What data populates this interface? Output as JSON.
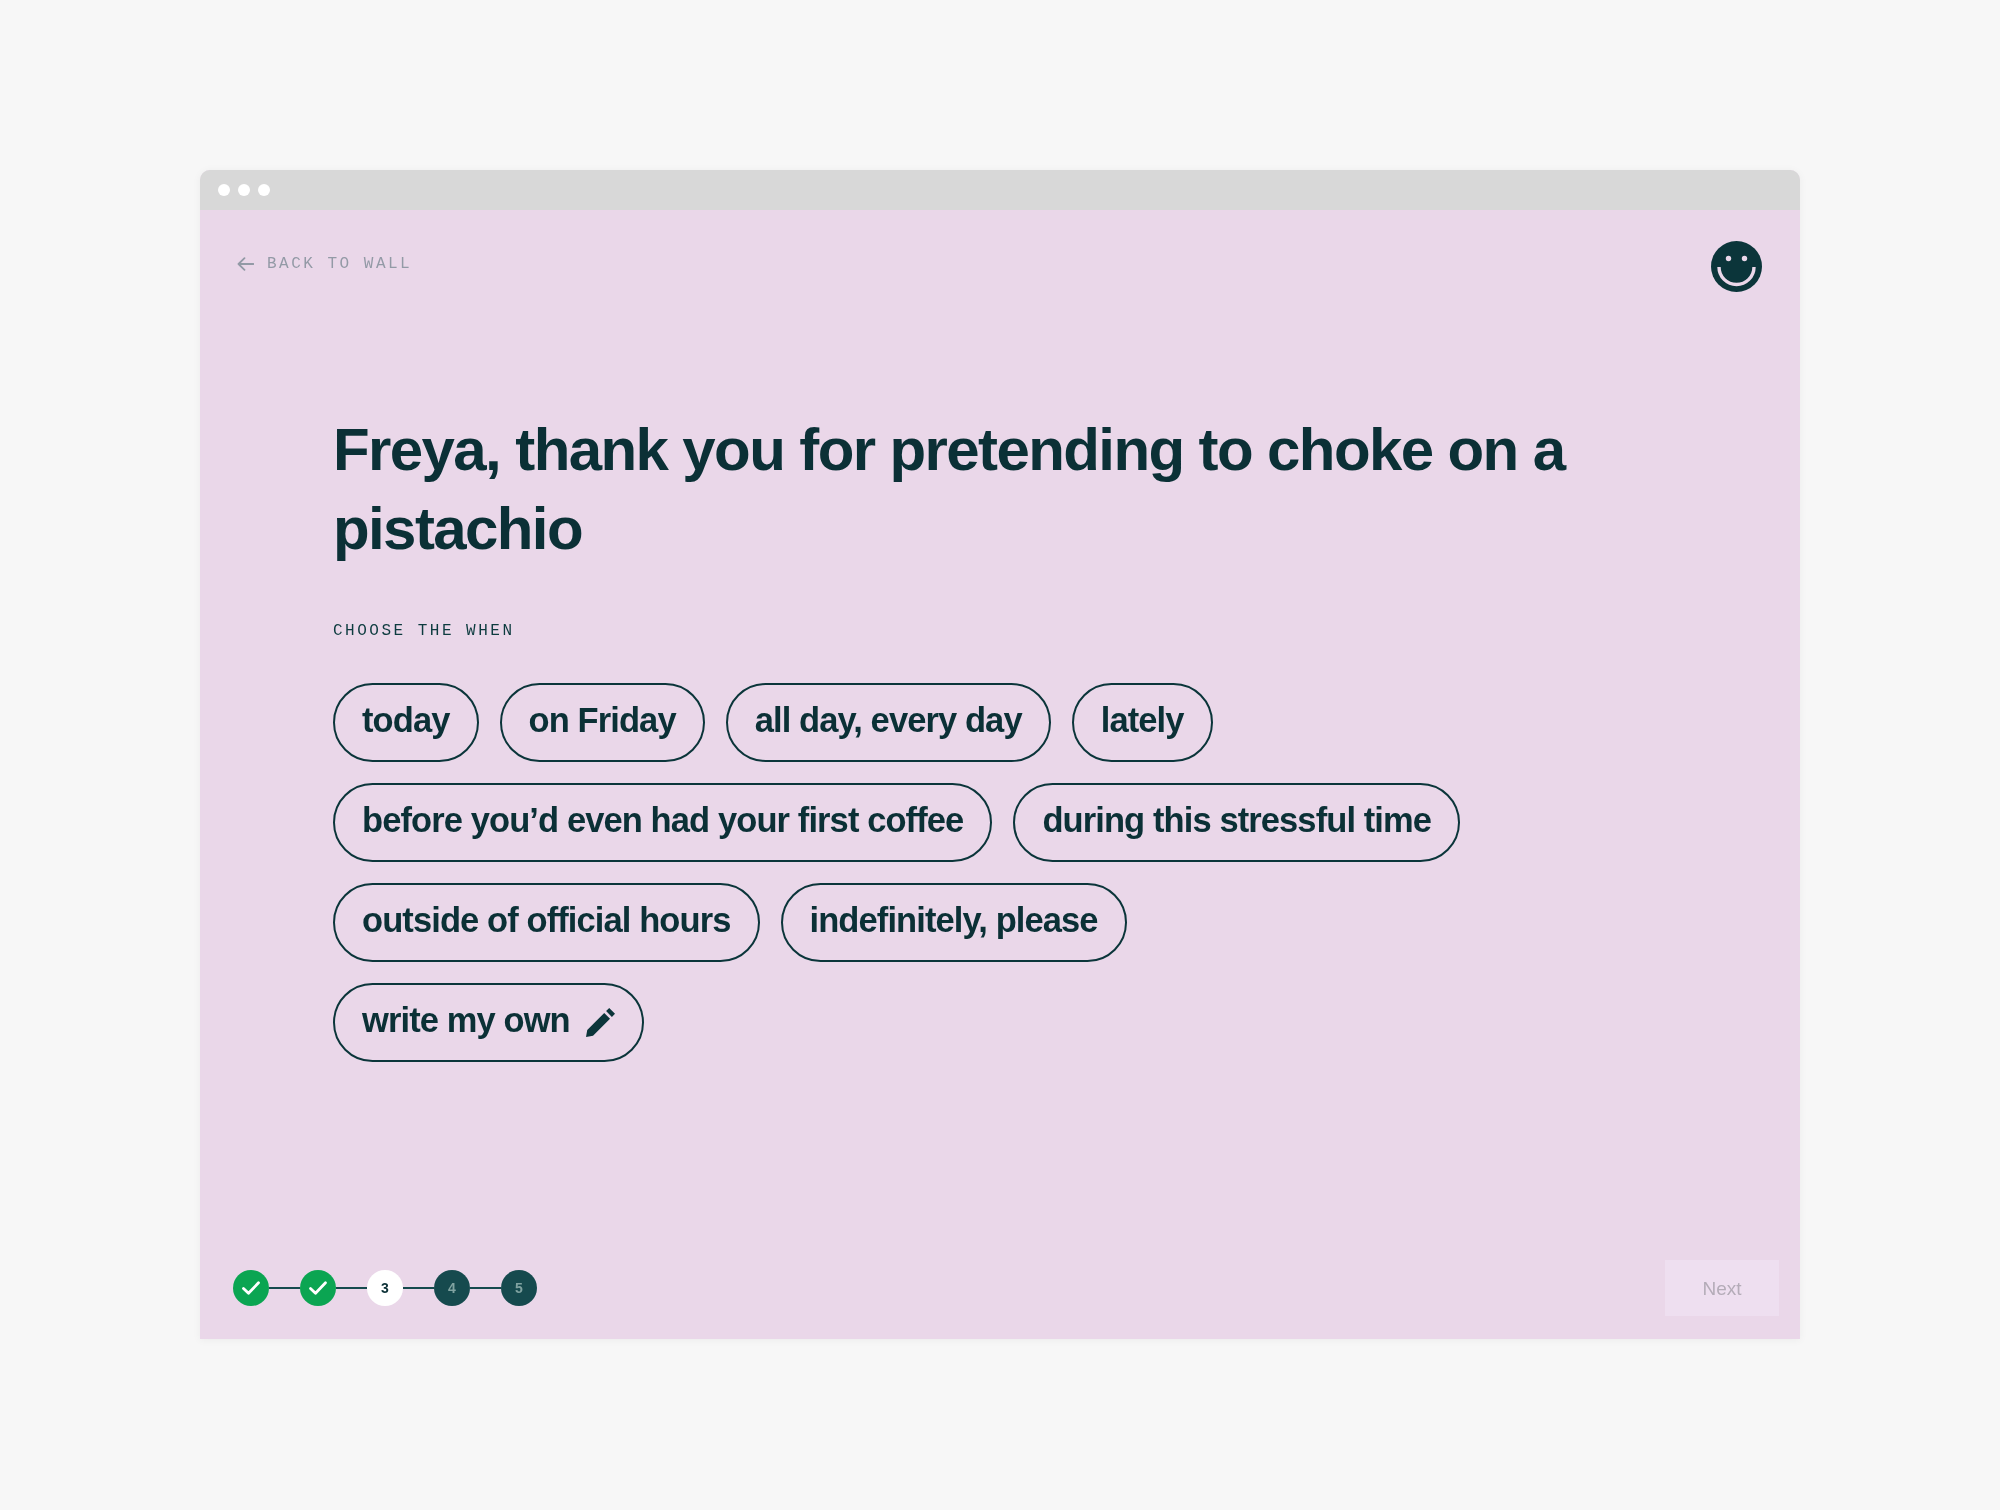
{
  "back_link": {
    "label": "BACK TO WALL"
  },
  "title": "Freya, thank you for pretending to choke on a pistachio",
  "prompt": "CHOOSE THE WHEN",
  "options": [
    {
      "label": "today",
      "kind": "preset",
      "selected": false
    },
    {
      "label": "on Friday",
      "kind": "preset",
      "selected": false
    },
    {
      "label": "all day, every day",
      "kind": "preset",
      "selected": false
    },
    {
      "label": "lately",
      "kind": "preset",
      "selected": false
    },
    {
      "label": "before you’d even had your first coffee",
      "kind": "preset",
      "selected": false
    },
    {
      "label": "during this stressful time",
      "kind": "preset",
      "selected": false
    },
    {
      "label": "outside of official hours",
      "kind": "preset",
      "selected": false
    },
    {
      "label": "indefinitely, please",
      "kind": "preset",
      "selected": false
    },
    {
      "label": "write my own",
      "kind": "custom",
      "selected": false
    }
  ],
  "steps": [
    {
      "completed": true,
      "current": false
    },
    {
      "completed": true,
      "current": false
    },
    {
      "label": "3",
      "completed": false,
      "current": true
    },
    {
      "label": "4",
      "completed": false,
      "current": false
    },
    {
      "label": "5",
      "completed": false,
      "current": false
    }
  ],
  "next_button": {
    "label": "Next",
    "disabled": true
  }
}
